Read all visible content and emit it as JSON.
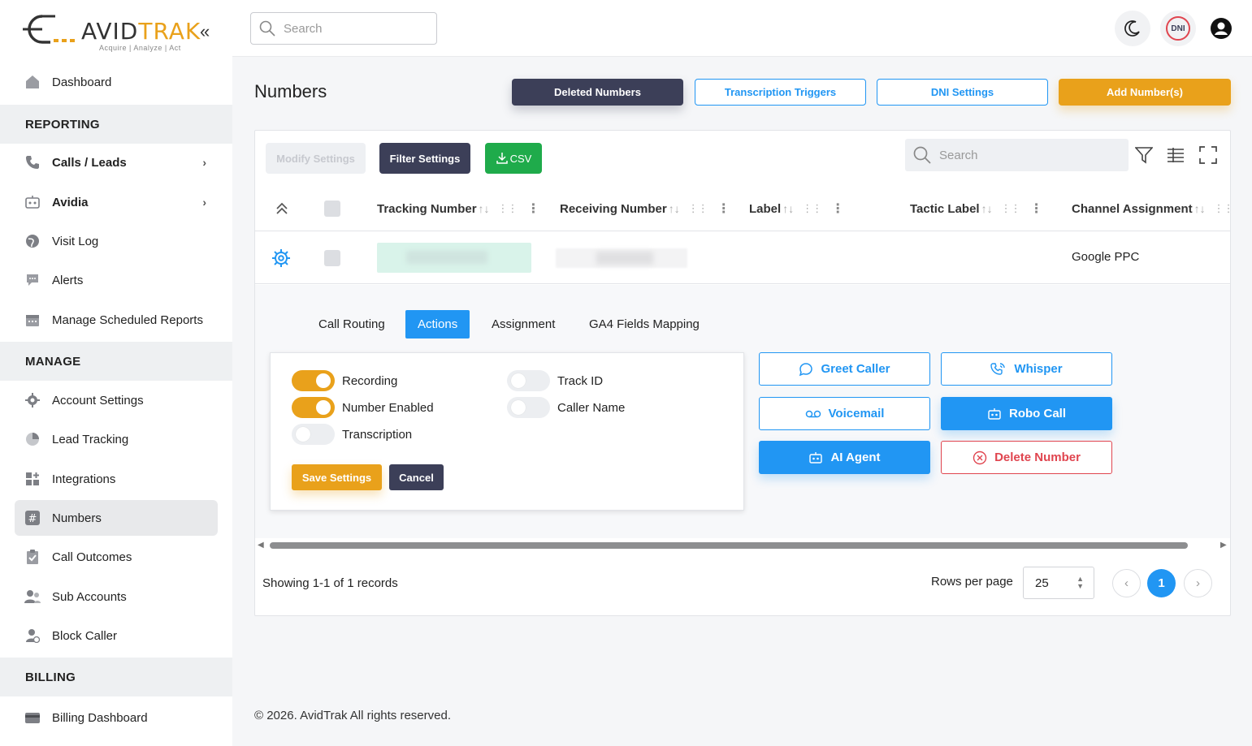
{
  "brand": {
    "name_part1": "AVID",
    "name_part2": "TRAK",
    "tagline": "Acquire  |  Analyze  |  Act",
    "accent": "#e9a11b"
  },
  "sidebar": {
    "items": [
      {
        "label": "Dashboard",
        "icon": "home-icon"
      },
      {
        "label": "Calls / Leads",
        "icon": "phone-icon"
      },
      {
        "label": "Avidia",
        "icon": "robot-icon"
      },
      {
        "label": "Visit Log",
        "icon": "globe-icon"
      },
      {
        "label": "Alerts",
        "icon": "chat-bubble-icon"
      },
      {
        "label": "Manage Scheduled Reports",
        "icon": "calendar-icon"
      },
      {
        "label": "Account Settings",
        "icon": "gear-icon"
      },
      {
        "label": "Lead Tracking",
        "icon": "pie-chart-icon"
      },
      {
        "label": "Integrations",
        "icon": "grid-plus-icon"
      },
      {
        "label": "Numbers",
        "icon": "hash-icon"
      },
      {
        "label": "Call Outcomes",
        "icon": "clipboard-icon"
      },
      {
        "label": "Sub Accounts",
        "icon": "users-icon"
      },
      {
        "label": "Block Caller",
        "icon": "user-block-icon"
      },
      {
        "label": "Billing Dashboard",
        "icon": "credit-card-icon"
      }
    ],
    "sections": {
      "reporting": "REPORTING",
      "manage": "MANAGE",
      "billing": "BILLING"
    }
  },
  "topbar": {
    "search_placeholder": "Search",
    "dni_label": "DNI"
  },
  "page": {
    "title": "Numbers",
    "buttons": {
      "deleted": "Deleted Numbers",
      "triggers": "Transcription Triggers",
      "dni": "DNI Settings",
      "add": "Add Number(s)"
    }
  },
  "table": {
    "toolbar": {
      "modify": "Modify Settings",
      "filter": "Filter Settings",
      "csv": "CSV",
      "search_placeholder": "Search"
    },
    "columns": [
      "Tracking Number",
      "Receiving Number",
      "Label",
      "Tactic Label",
      "Channel Assignment"
    ],
    "rows": [
      {
        "channel": "Google PPC"
      }
    ]
  },
  "expanded": {
    "tabs": [
      "Call Routing",
      "Actions",
      "Assignment",
      "GA4 Fields Mapping"
    ],
    "active_tab": "Actions",
    "toggles": {
      "recording": {
        "label": "Recording",
        "on": true
      },
      "number_enabled": {
        "label": "Number Enabled",
        "on": true
      },
      "transcription": {
        "label": "Transcription",
        "on": false
      },
      "track_id": {
        "label": "Track ID",
        "on": false
      },
      "caller_name": {
        "label": "Caller Name",
        "on": false
      }
    },
    "save": "Save Settings",
    "cancel": "Cancel",
    "actions": {
      "greet": "Greet Caller",
      "whisper": "Whisper",
      "voicemail": "Voicemail",
      "robo": "Robo Call",
      "ai": "AI Agent",
      "delete": "Delete Number"
    }
  },
  "footer": {
    "showing": "Showing 1-1 of 1 records",
    "rows_per_page_label": "Rows per page",
    "rows_per_page": "25",
    "current_page": "1"
  },
  "copyright": "© 2026. AvidTrak All rights reserved."
}
